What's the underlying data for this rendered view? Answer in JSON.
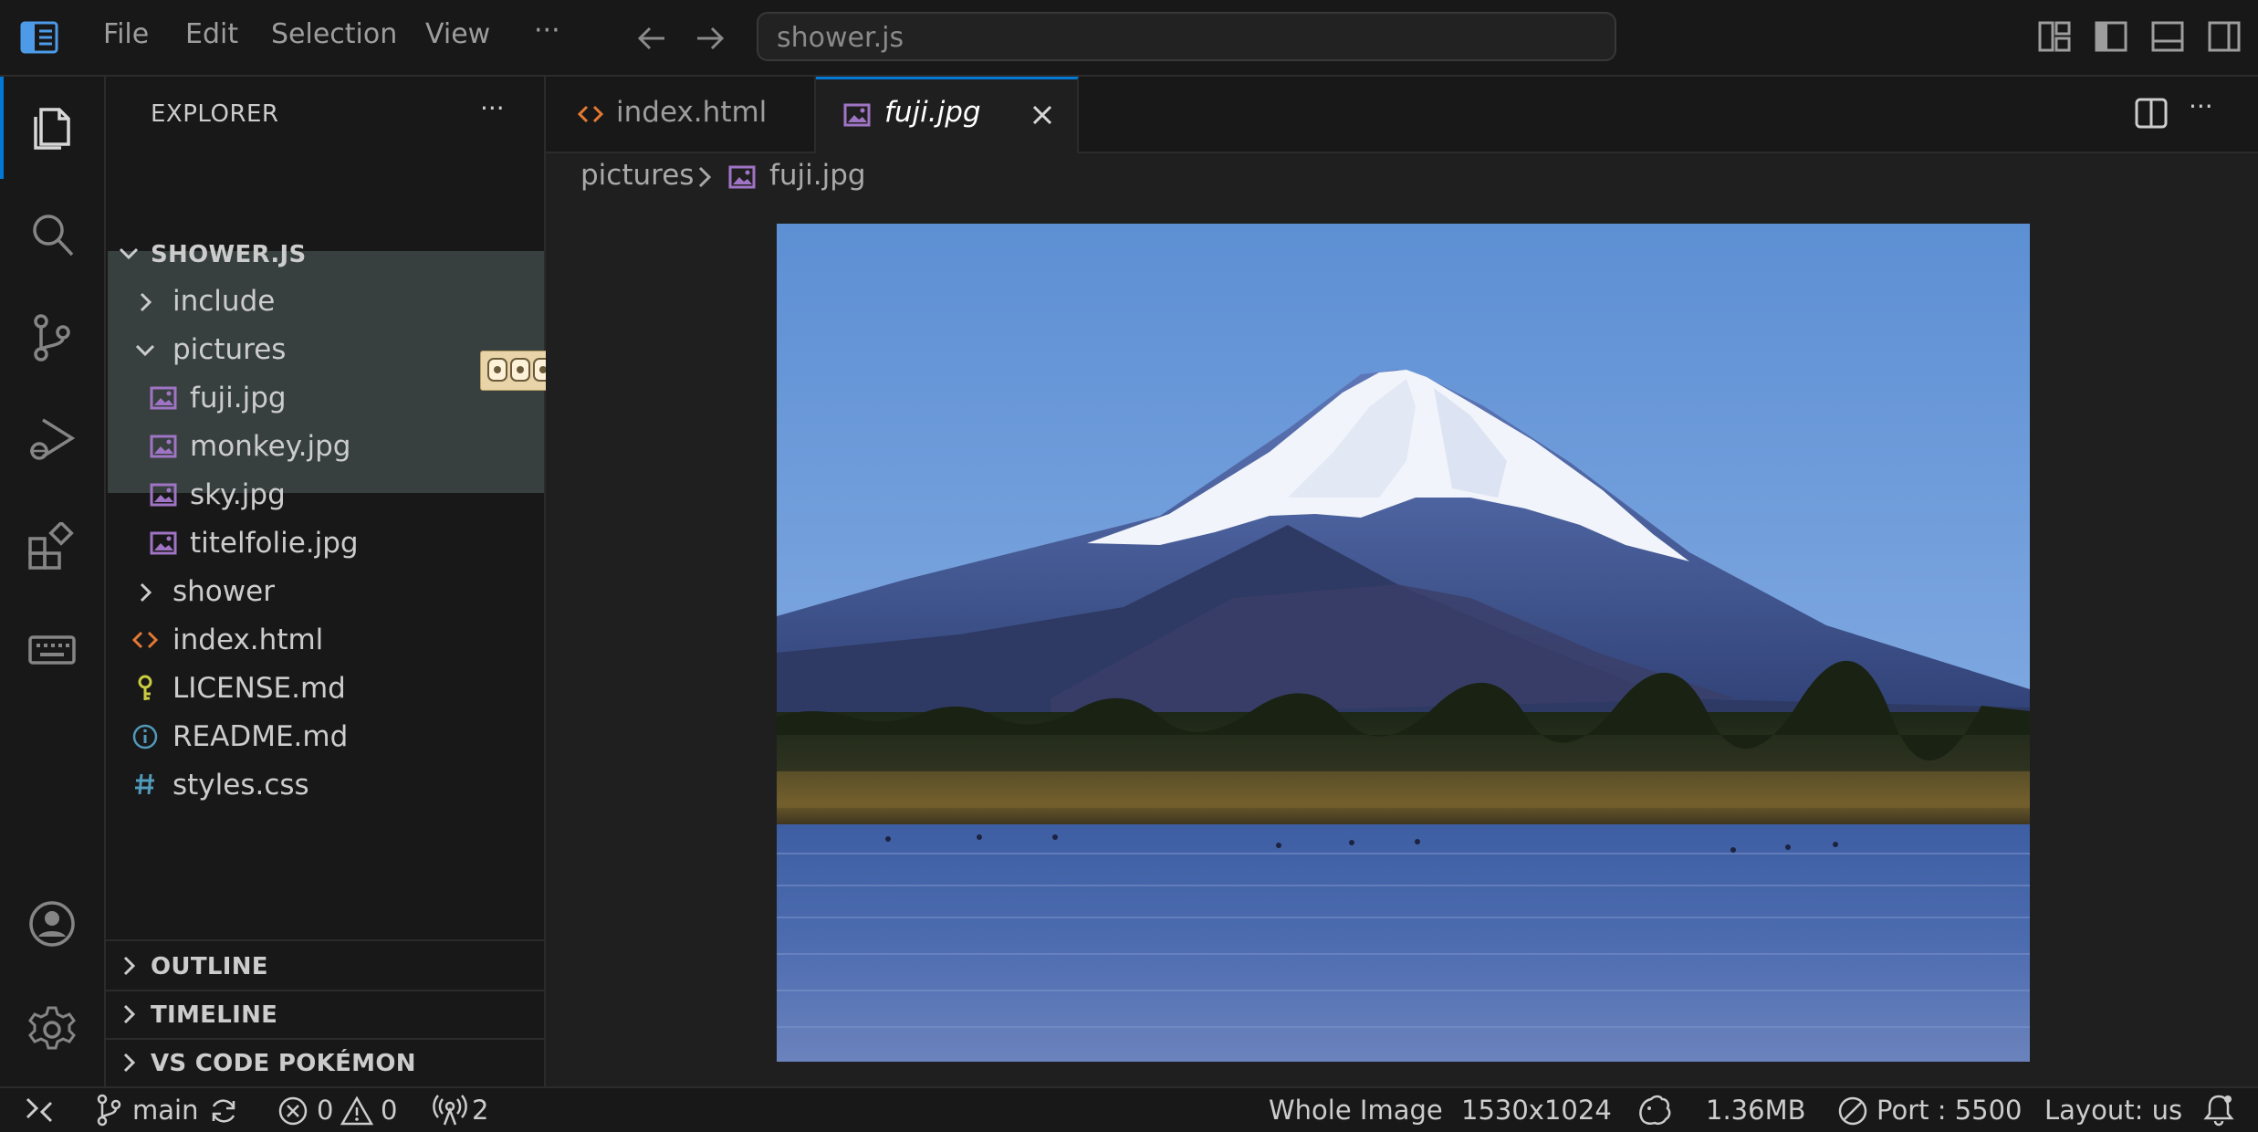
{
  "titlebar": {
    "menu": [
      "File",
      "Edit",
      "Selection",
      "View",
      "···"
    ],
    "search": "shower.js"
  },
  "sidebar": {
    "title": "EXPLORER",
    "more": "···",
    "root": "SHOWER.JS",
    "tree": [
      {
        "label": "include",
        "type": "folder",
        "expanded": false
      },
      {
        "label": "pictures",
        "type": "folder",
        "expanded": true
      },
      {
        "label": "fuji.jpg",
        "type": "image-file"
      },
      {
        "label": "monkey.jpg",
        "type": "image-file"
      },
      {
        "label": "sky.jpg",
        "type": "image-file"
      },
      {
        "label": "titelfolie.jpg",
        "type": "image-file"
      },
      {
        "label": "shower",
        "type": "folder",
        "expanded": false
      },
      {
        "label": "index.html",
        "type": "html-file"
      },
      {
        "label": "LICENSE.md",
        "type": "license-file"
      },
      {
        "label": "README.md",
        "type": "info-file"
      },
      {
        "label": "styles.css",
        "type": "css-file"
      }
    ],
    "sections": [
      "OUTLINE",
      "TIMELINE",
      "VS CODE POKÉMON"
    ]
  },
  "editor": {
    "tabs": [
      {
        "label": "index.html",
        "active": false
      },
      {
        "label": "fuji.jpg",
        "active": true
      }
    ],
    "breadcrumb": [
      "pictures",
      "fuji.jpg"
    ]
  },
  "statusbar": {
    "branch": "main",
    "errors": "0",
    "warnings": "0",
    "ports": "2",
    "zoom": "Whole Image",
    "dimensions": "1530x1024",
    "size": "1.36MB",
    "port": "Port : 5500",
    "layout": "Layout: us"
  },
  "colors": {
    "accent": "#0078d4",
    "html_icon": "#e37933",
    "image_icon": "#a074c4",
    "css_icon": "#519aba",
    "info_icon": "#519aba",
    "license_icon": "#cbcb41"
  }
}
